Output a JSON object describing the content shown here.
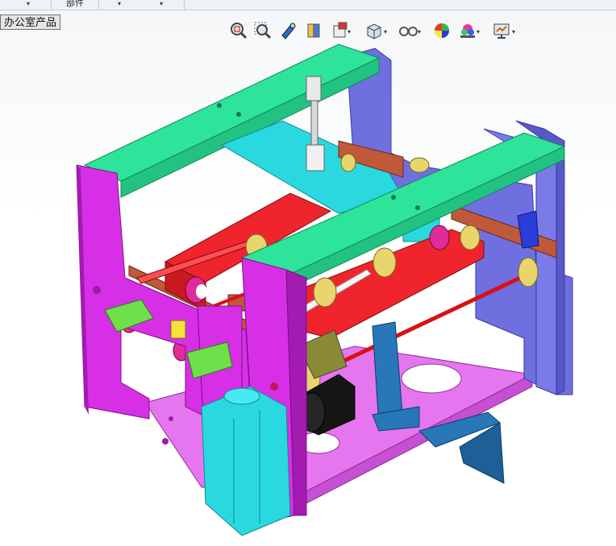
{
  "menu": {
    "items": [
      {
        "label": "▾"
      },
      {
        "label": "部件"
      },
      {
        "label": "▾"
      },
      {
        "label": "▾"
      }
    ]
  },
  "tab": {
    "label": "办公室产品"
  },
  "heads_up_toolbar": {
    "buttons": [
      {
        "icon": "zoom-to-fit-icon"
      },
      {
        "icon": "zoom-to-area-icon"
      },
      {
        "icon": "previous-view-icon"
      },
      {
        "icon": "section-view-icon"
      },
      {
        "icon": "view-orientation-icon"
      },
      {
        "icon": "display-style-icon"
      },
      {
        "icon": "hide-show-items-icon"
      },
      {
        "icon": "edit-appearance-icon"
      },
      {
        "icon": "apply-scene-icon"
      },
      {
        "icon": "view-settings-icon"
      }
    ]
  },
  "colors": {
    "green_plate": "#2ee39a",
    "blue_plate": "#6f6fe0",
    "magenta_frame": "#d72fe6",
    "pink_base": "#e676ef",
    "red_bar": "#f0242c",
    "cyan_part": "#2ad8e0",
    "orange_part": "#c0593a",
    "yellow_roller": "#e8d56e",
    "steel_blue": "#2877b8"
  }
}
